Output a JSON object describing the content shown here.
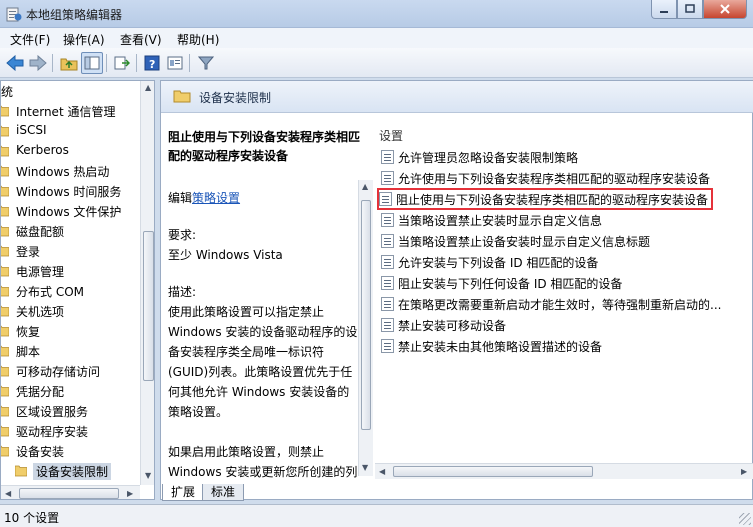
{
  "window": {
    "title": "本地组策略编辑器"
  },
  "menu": {
    "file": "文件(F)",
    "action": "操作(A)",
    "view": "查看(V)",
    "help": "帮助(H)"
  },
  "tree": {
    "root_label": "系统",
    "items": [
      "Internet 通信管理",
      "iSCSI",
      "Kerberos",
      "Windows 热启动",
      "Windows 时间服务",
      "Windows 文件保护",
      "磁盘配额",
      "登录",
      "电源管理",
      "分布式 COM",
      "关机选项",
      "恢复",
      "脚本",
      "可移动存储访问",
      "凭据分配",
      "区域设置服务",
      "驱动程序安装",
      "设备安装"
    ],
    "selected_child": "设备安装限制"
  },
  "header": {
    "title": "设备安装限制"
  },
  "description": {
    "title": "阻止使用与下列设备安装程序类相匹配的驱动程序安装设备",
    "edit_prefix": "编辑",
    "edit_link": "策略设置",
    "req_label": "要求:",
    "req_value": "至少 Windows Vista",
    "desc_label": "描述:",
    "desc_text": "使用此策略设置可以指定禁止 Windows 安装的设备驱动程序的设备安装程序类全局唯一标识符(GUID)列表。此策略设置优先于任何其他允许 Windows 安装设备的策略设置。",
    "desc_text2": "如果启用此策略设置，则禁止 Windows 安装或更新您所创建的列表中列出了其设备安装程序类"
  },
  "settings": {
    "column_header": "设置",
    "items": [
      "允许管理员忽略设备安装限制策略",
      "允许使用与下列设备安装程序类相匹配的驱动程序安装设备",
      "阻止使用与下列设备安装程序类相匹配的驱动程序安装设备",
      "当策略设置禁止安装时显示自定义信息",
      "当策略设置禁止设备安装时显示自定义信息标题",
      "允许安装与下列设备 ID 相匹配的设备",
      "阻止安装与下列任何设备 ID 相匹配的设备",
      "在策略更改需要重新启动才能生效时，等待强制重新启动的...",
      "禁止安装可移动设备",
      "禁止安装未由其他策略设置描述的设备"
    ]
  },
  "tabs": {
    "extended": "扩展",
    "standard": "标准"
  },
  "status": {
    "text": "10 个设置"
  }
}
